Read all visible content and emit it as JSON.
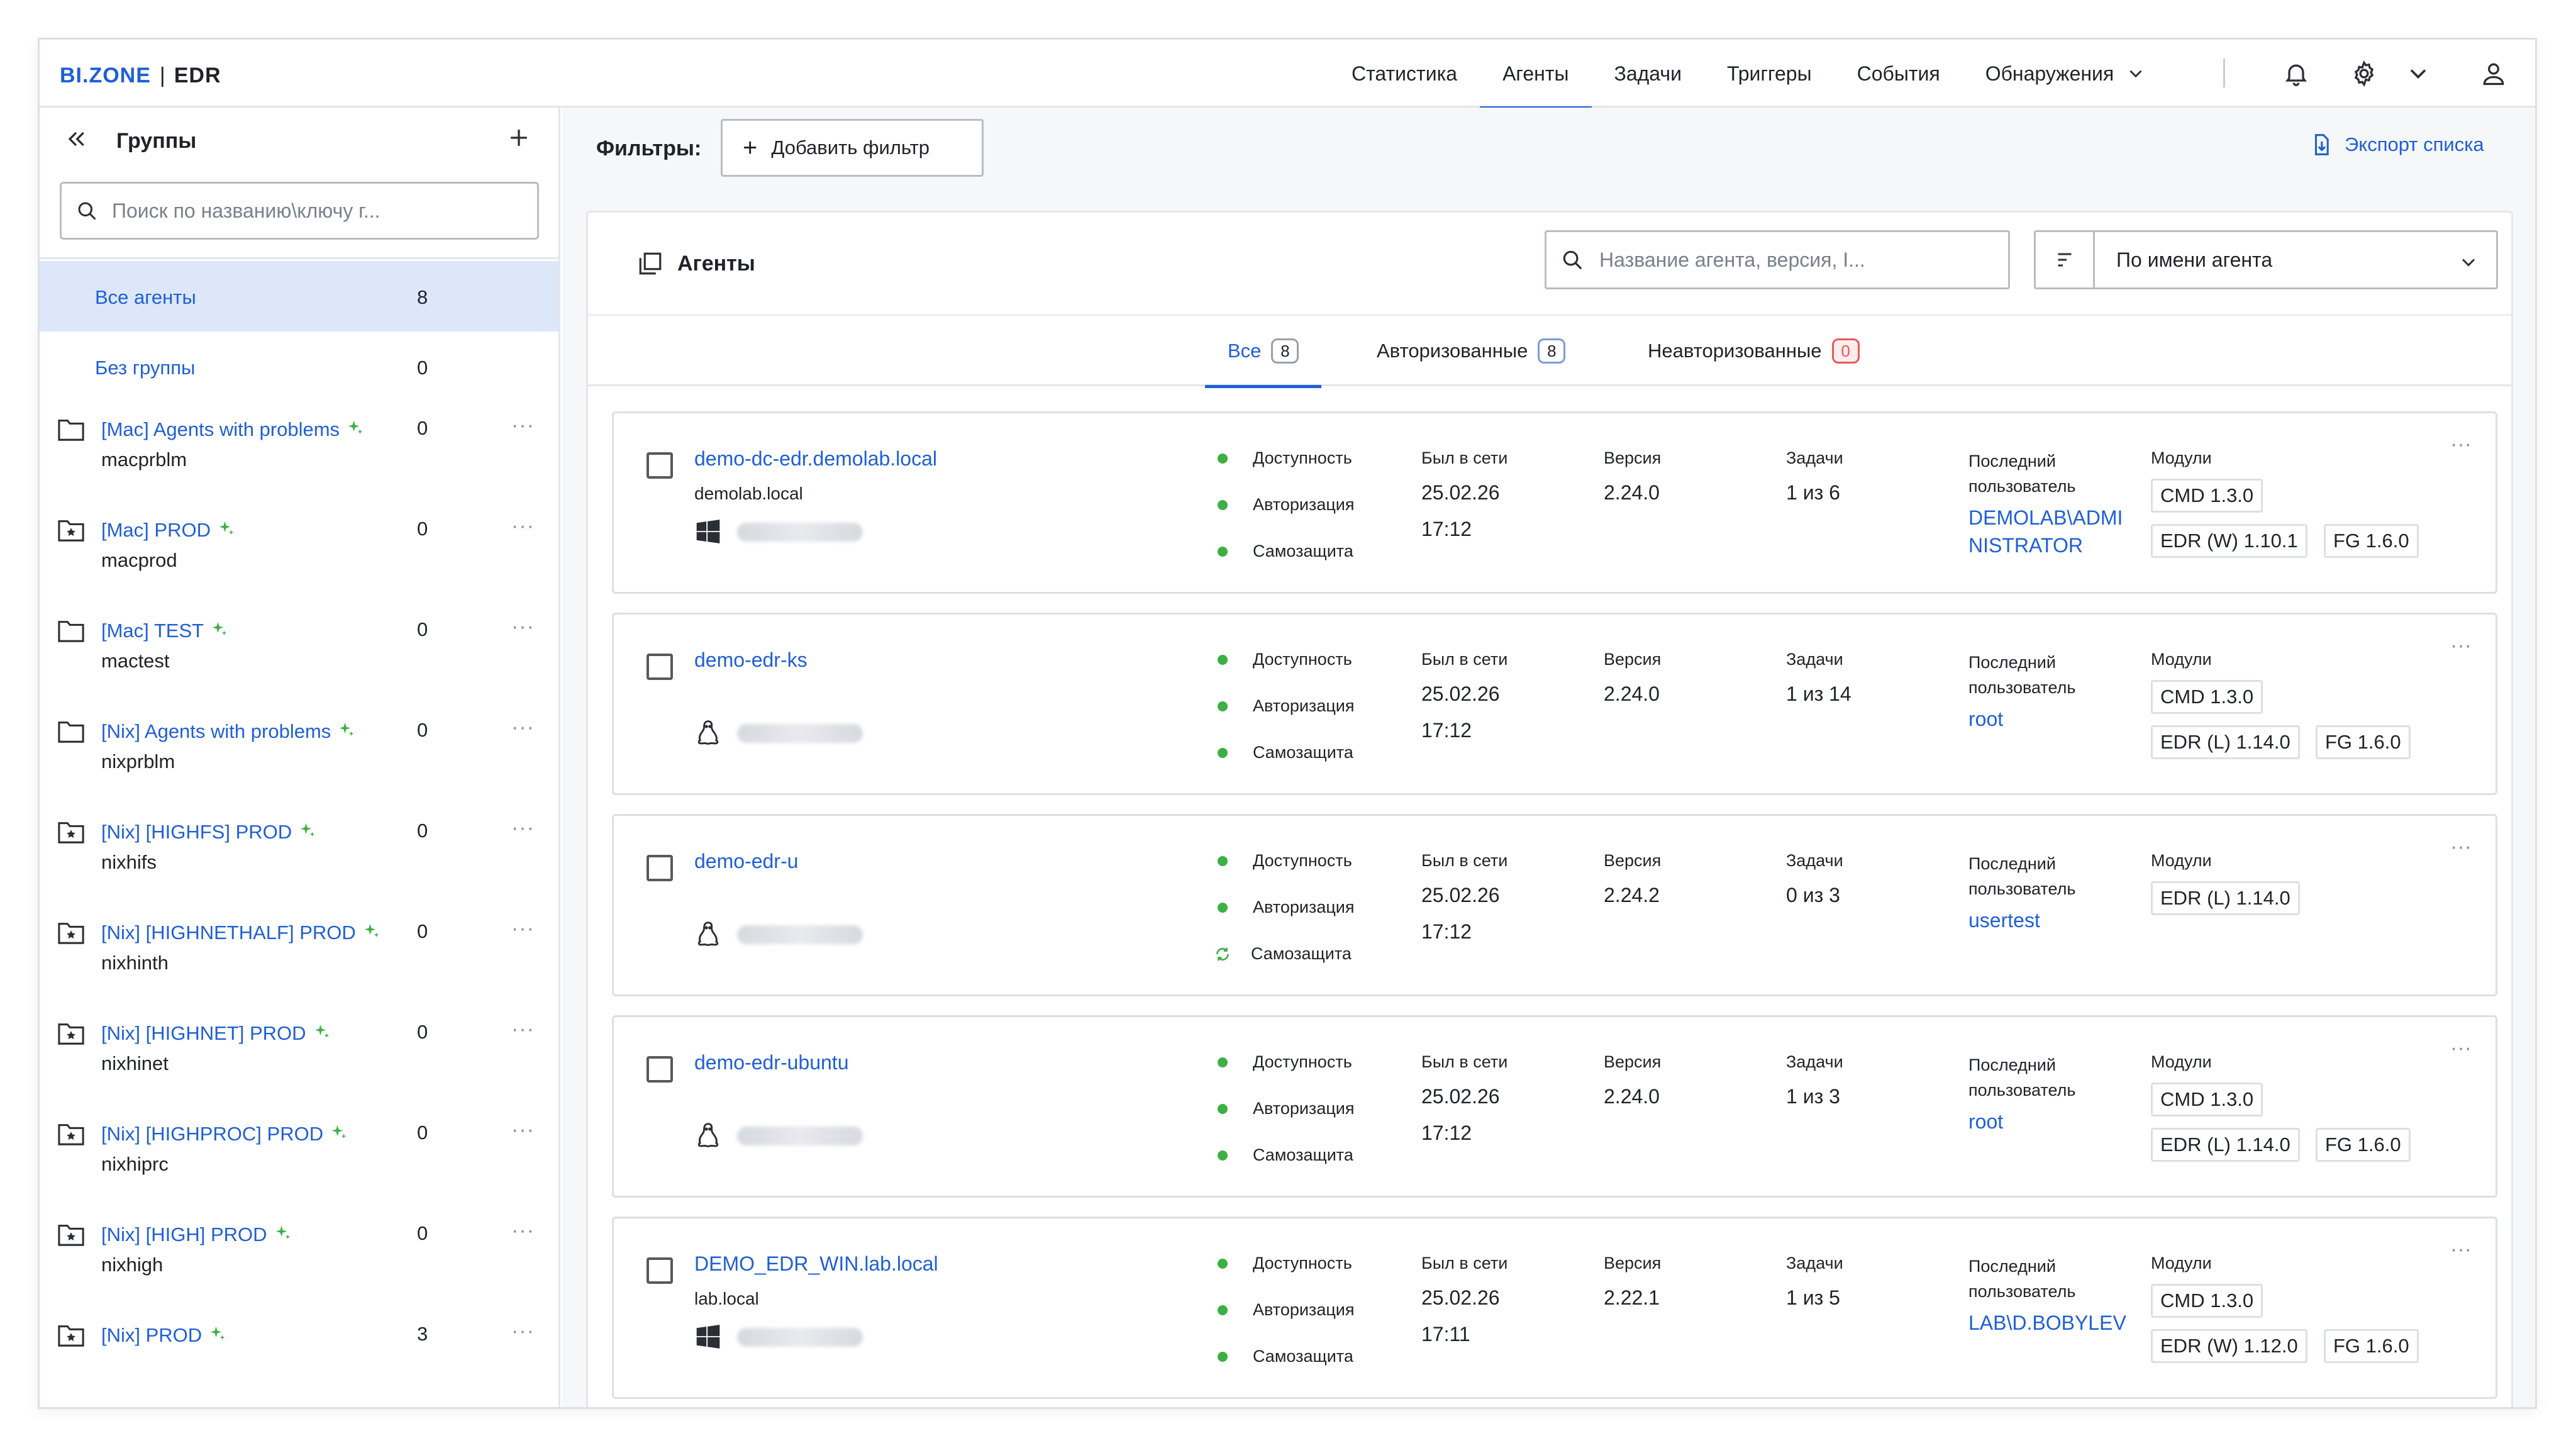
{
  "header": {
    "logo_bi": "BI.ZONE",
    "logo_sep": "|",
    "logo_product": "EDR",
    "nav": [
      {
        "label": "Статистика",
        "active": false
      },
      {
        "label": "Агенты",
        "active": true
      },
      {
        "label": "Задачи",
        "active": false
      },
      {
        "label": "Триггеры",
        "active": false
      },
      {
        "label": "События",
        "active": false
      },
      {
        "label": "Обнаружения",
        "active": false
      }
    ],
    "icons": [
      "bell-icon",
      "gear-icon",
      "chevron-down-icon",
      "user-icon",
      "chevron-down-icon"
    ]
  },
  "sidebar": {
    "title": "Группы",
    "search_placeholder": "Поиск по названию\\ключу г...",
    "all_agents": {
      "label": "Все агенты",
      "count": "8"
    },
    "no_group": {
      "label": "Без группы",
      "count": "0"
    },
    "groups": [
      {
        "name": "[Mac] Agents with problems",
        "key": "macprblm",
        "count": "0",
        "icon": "folder-icon"
      },
      {
        "name": "[Mac] PROD",
        "key": "macprod",
        "count": "0",
        "icon": "folder-star-icon"
      },
      {
        "name": "[Mac] TEST",
        "key": "mactest",
        "count": "0",
        "icon": "folder-icon"
      },
      {
        "name": "[Nix] Agents with problems",
        "key": "nixprblm",
        "count": "0",
        "icon": "folder-icon"
      },
      {
        "name": "[Nix] [HIGHFS] PROD",
        "key": "nixhifs",
        "count": "0",
        "icon": "folder-star-icon"
      },
      {
        "name": "[Nix] [HIGHNETHALF] PROD",
        "key": "nixhinth",
        "count": "0",
        "icon": "folder-star-icon"
      },
      {
        "name": "[Nix] [HIGHNET] PROD",
        "key": "nixhinet",
        "count": "0",
        "icon": "folder-star-icon"
      },
      {
        "name": "[Nix] [HIGHPROC] PROD",
        "key": "nixhiprc",
        "count": "0",
        "icon": "folder-star-icon"
      },
      {
        "name": "[Nix] [HIGH] PROD",
        "key": "nixhigh",
        "count": "0",
        "icon": "folder-star-icon"
      },
      {
        "name": "[Nix] PROD",
        "key": "",
        "count": "3",
        "icon": "folder-star-icon"
      }
    ]
  },
  "main": {
    "filters_label": "Фильтры:",
    "add_filter": "Добавить фильтр",
    "export": "Экспорт списка",
    "panel_title": "Агенты",
    "agent_search_placeholder": "Название агента, версия, I...",
    "sort_value": "По имени агента",
    "tabs": [
      {
        "label": "Все",
        "count": "8",
        "style": "all"
      },
      {
        "label": "Авторизованные",
        "count": "8",
        "style": "blue"
      },
      {
        "label": "Неавторизованные",
        "count": "0",
        "style": "red"
      }
    ],
    "labels": {
      "availability": "Доступность",
      "authorization": "Авторизация",
      "selfprotect": "Самозащита",
      "last_seen": "Был в сети",
      "version": "Версия",
      "tasks": "Задачи",
      "last_user": "Последний пользователь",
      "modules": "Модули"
    },
    "agents": [
      {
        "name": "demo-dc-edr.demolab.local",
        "domain": "demolab.local",
        "os": "windows",
        "date": "25.02.26",
        "time": "17:12",
        "version": "2.24.0",
        "tasks": "1 из 6",
        "user": "DEMOLAB\\ADMINISTRATOR",
        "selfprotect_state": "ok",
        "modules": [
          "CMD 1.3.0",
          "EDR (W) 1.10.1",
          "FG 1.6.0"
        ]
      },
      {
        "name": "demo-edr-ks",
        "domain": "",
        "os": "linux",
        "date": "25.02.26",
        "time": "17:12",
        "version": "2.24.0",
        "tasks": "1 из 14",
        "user": "root",
        "selfprotect_state": "ok",
        "modules": [
          "CMD 1.3.0",
          "EDR (L) 1.14.0",
          "FG 1.6.0"
        ]
      },
      {
        "name": "demo-edr-u",
        "domain": "",
        "os": "linux",
        "date": "25.02.26",
        "time": "17:12",
        "version": "2.24.2",
        "tasks": "0 из 3",
        "user": "usertest",
        "selfprotect_state": "sync",
        "modules": [
          "EDR (L) 1.14.0"
        ]
      },
      {
        "name": "demo-edr-ubuntu",
        "domain": "",
        "os": "linux",
        "date": "25.02.26",
        "time": "17:12",
        "version": "2.24.0",
        "tasks": "1 из 3",
        "user": "root",
        "selfprotect_state": "ok",
        "modules": [
          "CMD 1.3.0",
          "EDR (L) 1.14.0",
          "FG 1.6.0"
        ]
      },
      {
        "name": "DEMO_EDR_WIN.lab.local",
        "domain": "lab.local",
        "os": "windows",
        "date": "25.02.26",
        "time": "17:11",
        "version": "2.22.1",
        "tasks": "1 из 5",
        "user": "LAB\\D.BOBYLEV",
        "selfprotect_state": "ok",
        "modules": [
          "CMD 1.3.0",
          "EDR (W) 1.12.0",
          "FG 1.6.0"
        ]
      }
    ]
  },
  "colors": {
    "accent": "#1f5fd6",
    "ok": "#3cb043",
    "danger": "#e35b5b",
    "selected_bg": "#dde7f9"
  }
}
